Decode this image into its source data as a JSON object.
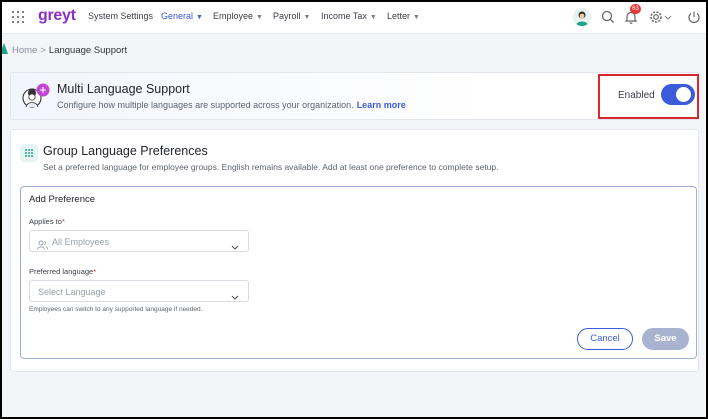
{
  "brand": {
    "logo_text": "greyt",
    "accent": "#3b5bdb",
    "logo_color": "#8b2fc9"
  },
  "nav": {
    "items": [
      {
        "label": "System Settings",
        "dropdown": false,
        "active": false
      },
      {
        "label": "General",
        "dropdown": true,
        "active": true
      },
      {
        "label": "Employee",
        "dropdown": true,
        "active": false
      },
      {
        "label": "Payroll",
        "dropdown": true,
        "active": false
      },
      {
        "label": "Income Tax",
        "dropdown": true,
        "active": false
      },
      {
        "label": "Letter",
        "dropdown": true,
        "active": false
      }
    ],
    "notification_count": "63",
    "icons": [
      "apps-grid-icon",
      "search-icon",
      "bell-icon",
      "gear-icon",
      "power-icon"
    ]
  },
  "breadcrumb": {
    "home": "Home",
    "separator": ">",
    "current": "Language Support"
  },
  "multi_language": {
    "title": "Multi Language Support",
    "description": "Configure how multiple languages are supported across your organization.",
    "learn_more": "Learn more",
    "status_label": "Enabled",
    "enabled": true
  },
  "group_prefs": {
    "title": "Group Language Preferences",
    "description": "Set a preferred language for employee groups. English remains available. Add at least one preference to complete setup.",
    "add_panel": {
      "title": "Add Preference",
      "applies_to_label": "Applies to",
      "applies_to_value": "All Employees",
      "preferred_language_label": "Preferred language",
      "preferred_language_placeholder": "Select Language",
      "hint": "Employees can switch to any supported language if needed.",
      "required_mark": "*",
      "cancel_label": "Cancel",
      "save_label": "Save"
    }
  }
}
